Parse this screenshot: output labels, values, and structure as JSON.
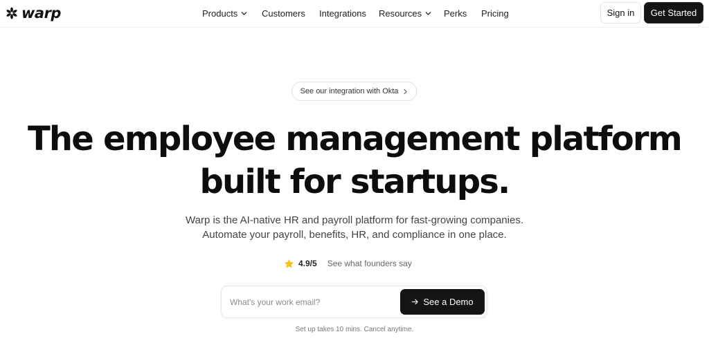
{
  "brand": {
    "name": "warp"
  },
  "nav": {
    "items": [
      {
        "label": "Products",
        "has_dropdown": true
      },
      {
        "label": "Customers",
        "has_dropdown": false
      },
      {
        "label": "Integrations",
        "has_dropdown": false
      },
      {
        "label": "Resources",
        "has_dropdown": true
      },
      {
        "label": "Perks",
        "has_dropdown": false
      },
      {
        "label": "Pricing",
        "has_dropdown": false
      }
    ],
    "sign_in": "Sign in",
    "get_started": "Get Started"
  },
  "hero": {
    "announcement": "See our integration with Okta",
    "headline_line1": "The employee management platform",
    "headline_line2": "built for startups.",
    "sub_line1": "Warp is the AI-native HR and payroll platform for fast-growing companies.",
    "sub_line2": "Automate your payroll, benefits, HR, and compliance in one place.",
    "rating_score": "4.9/5",
    "rating_link": "See what founders say",
    "email_placeholder": "What's your work email?",
    "email_value": "",
    "demo_button": "See a Demo",
    "note": "Set up takes 10 mins. Cancel anytime."
  },
  "colors": {
    "button_dark": "#141414",
    "star": "#f5c518",
    "text_primary": "#0d0d0d",
    "text_muted": "#666666"
  },
  "icons": {
    "logo": "asterisk-logo-icon",
    "dropdown": "chevron-down-icon",
    "pill": "chevron-right-icon",
    "rating": "star-icon",
    "demo": "arrow-right-icon"
  }
}
